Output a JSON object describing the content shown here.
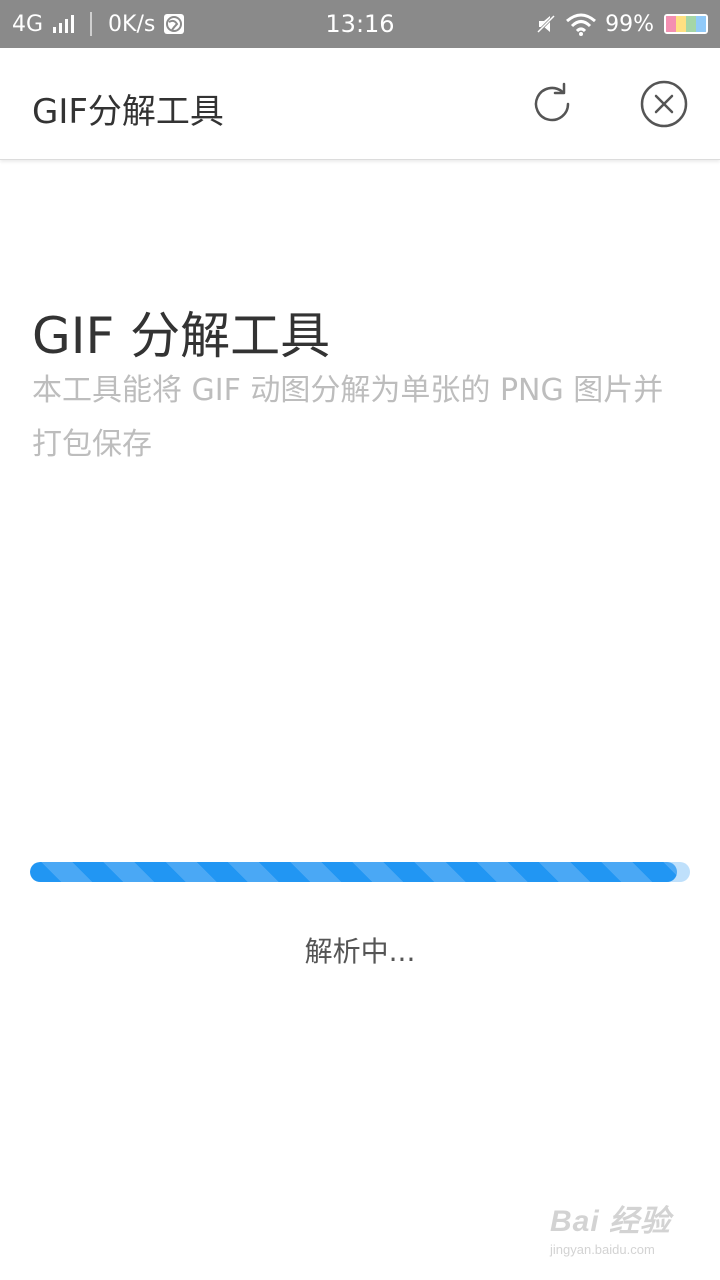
{
  "status_bar": {
    "network": "4G",
    "speed": "0K/s",
    "time": "13:16",
    "battery": "99%",
    "icons": [
      "signal-icon",
      "vpn-globe-icon",
      "mute-icon",
      "wifi-icon",
      "battery-icon"
    ]
  },
  "app_bar": {
    "title": "GIF分解工具",
    "refresh_icon": "refresh-icon",
    "close_icon": "close-circle-icon"
  },
  "content": {
    "headline": "GIF 分解工具",
    "description": "本工具能将 GIF 动图分解为单张的 PNG 图片并打包保存"
  },
  "progress": {
    "value_fraction": 0.98,
    "label": "解析中...",
    "color": "#2196f3",
    "track_color": "#bfe0fb"
  },
  "watermark": {
    "logo": "Bai 经验",
    "url": "jingyan.baidu.com"
  }
}
